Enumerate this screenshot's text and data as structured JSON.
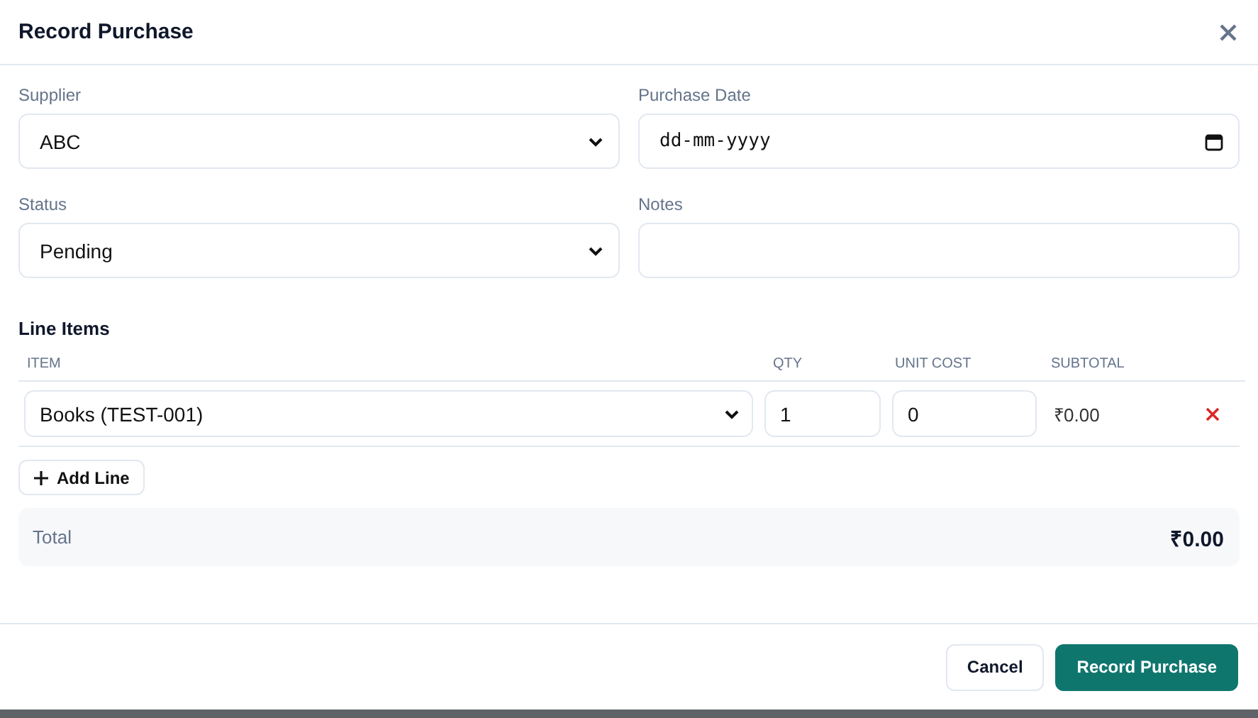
{
  "dialog": {
    "title": "Record Purchase"
  },
  "fields": [
    {
      "label": "Supplier",
      "kind": "select",
      "value": "ABC"
    },
    {
      "label": "Purchase Date",
      "kind": "date",
      "placeholder": "dd-mm-yyyy"
    },
    {
      "label": "Status",
      "kind": "select",
      "value": "Pending"
    },
    {
      "label": "Notes",
      "kind": "text"
    }
  ],
  "line_items": {
    "title": "Line Items",
    "columns": [
      "ITEM",
      "QTY",
      "UNIT COST",
      "SUBTOTAL"
    ],
    "rows": [
      {
        "item": "Books (TEST-001)",
        "qty": "1",
        "unit_cost": "0",
        "subtotal": "₹0.00"
      }
    ],
    "add_button": "Add Line"
  },
  "total": {
    "label": "Total",
    "value": "₹0.00"
  },
  "buttons": [
    {
      "label": "Cancel",
      "kind": "secondary"
    },
    {
      "label": "Record Purchase",
      "kind": "primary"
    }
  ]
}
